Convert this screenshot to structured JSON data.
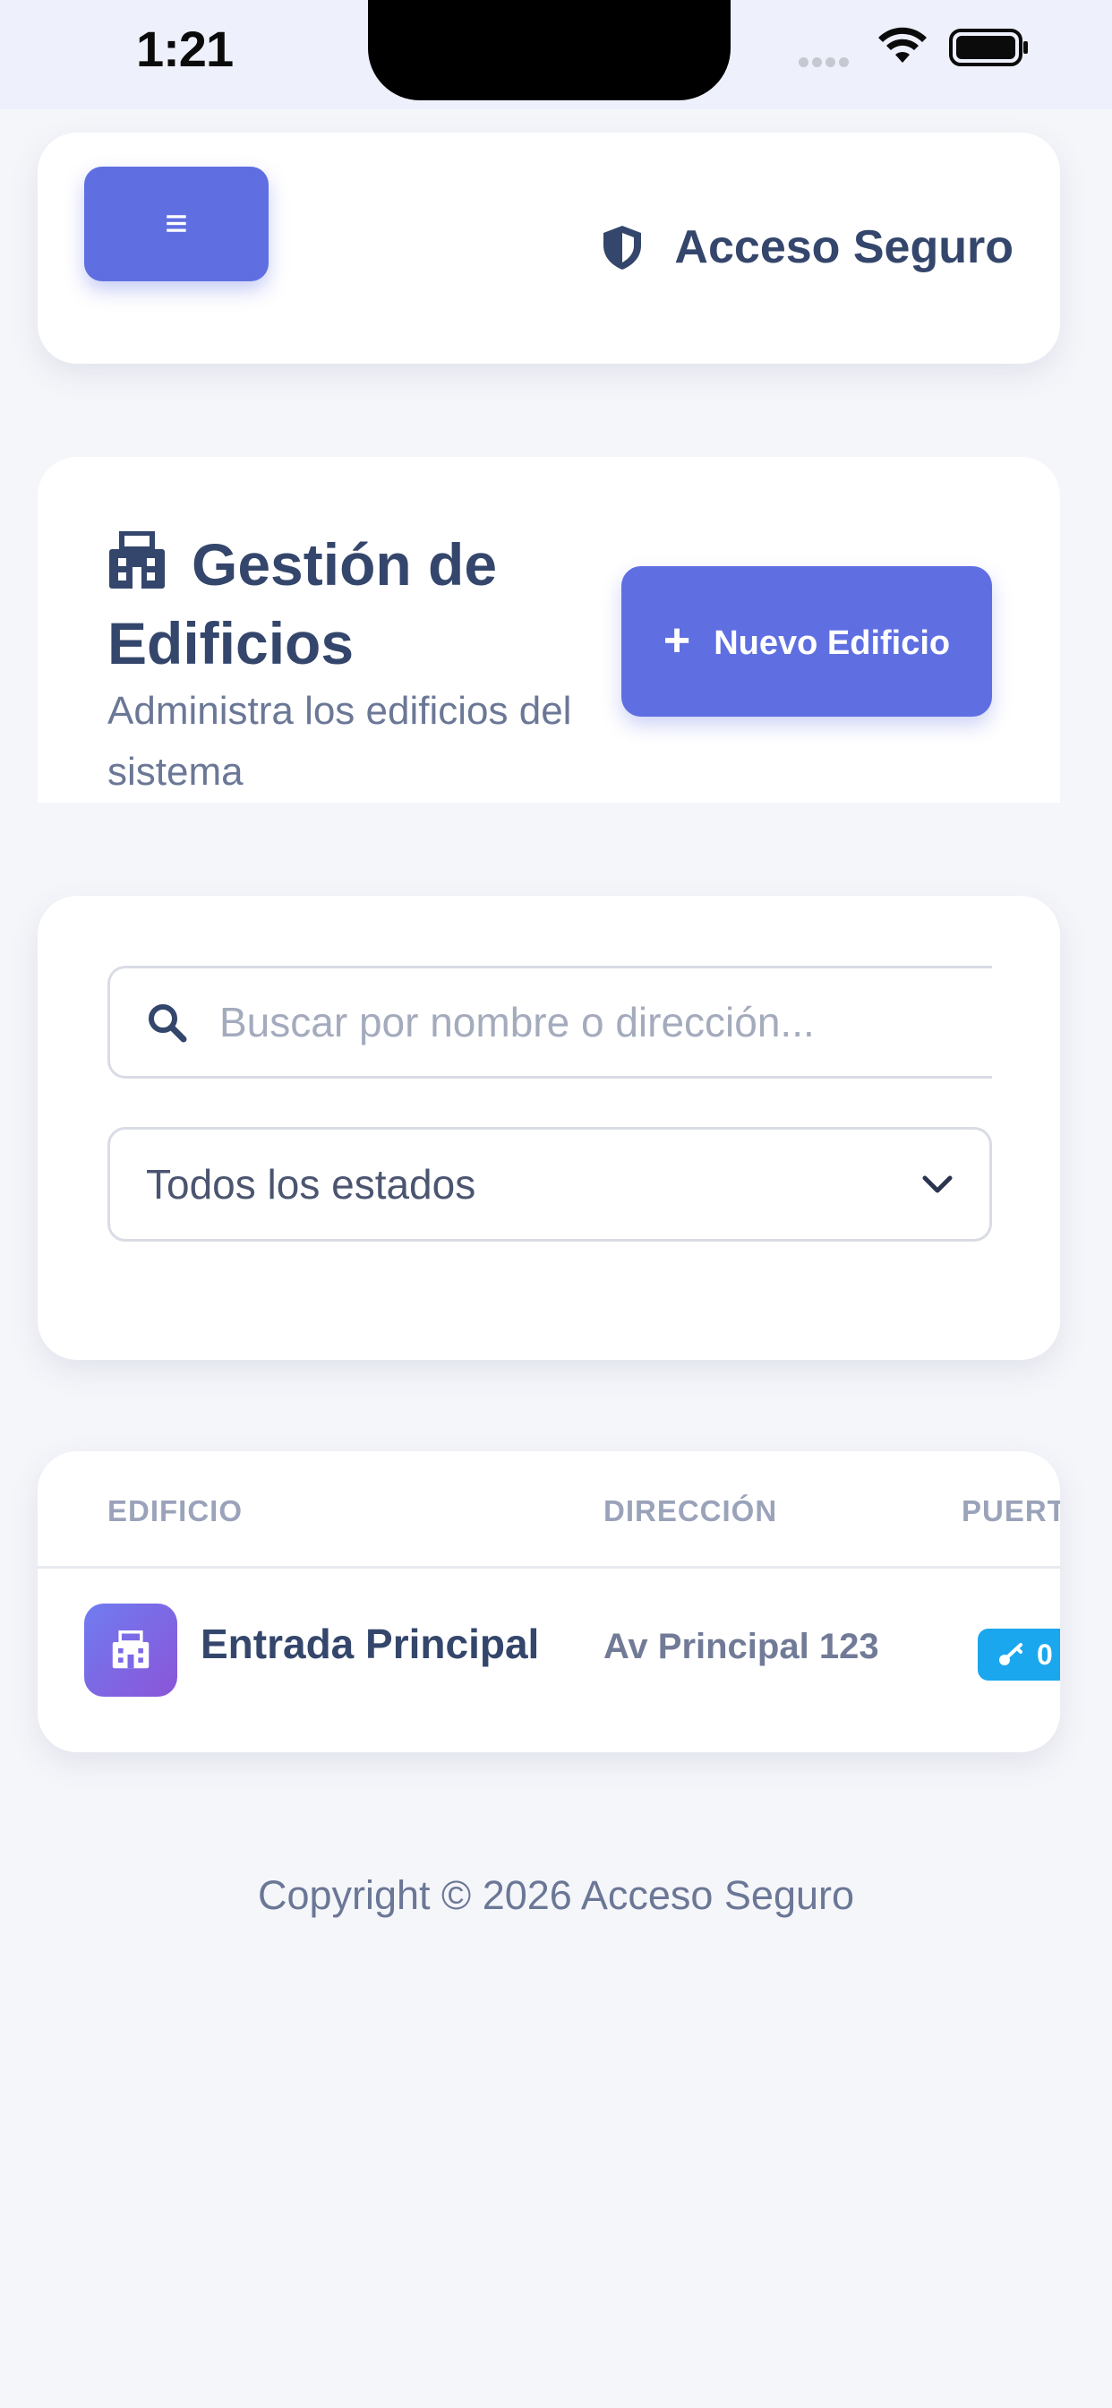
{
  "status_bar": {
    "time": "1:21",
    "icons": [
      "signal-icon",
      "wifi-icon",
      "battery-icon"
    ]
  },
  "header": {
    "menu_icon": "≡",
    "brand_icon": "shield-icon",
    "brand_name": "Acceso Seguro"
  },
  "page": {
    "title_icon": "building-icon",
    "title": "Gestión de Edificios",
    "subtitle": "Administra los edificios del sistema",
    "new_button_icon": "+",
    "new_button_label": "Nuevo Edificio"
  },
  "filters": {
    "search_placeholder": "Buscar por nombre o dirección...",
    "search_value": "",
    "status_selected": "Todos los estados"
  },
  "table": {
    "columns": [
      "EDIFICIO",
      "DIRECCIÓN",
      "PUERTAS"
    ],
    "rows": [
      {
        "name": "Entrada Principal",
        "address": "Av Principal 123",
        "doors": "0"
      }
    ]
  },
  "footer": {
    "copyright": "Copyright © 2026 Acceso Seguro"
  },
  "colors": {
    "primary": "#5f6fe1",
    "text": "#34466b",
    "muted": "#6b7796",
    "badge": "#1aa7ee",
    "background": "#f5f6fa"
  }
}
